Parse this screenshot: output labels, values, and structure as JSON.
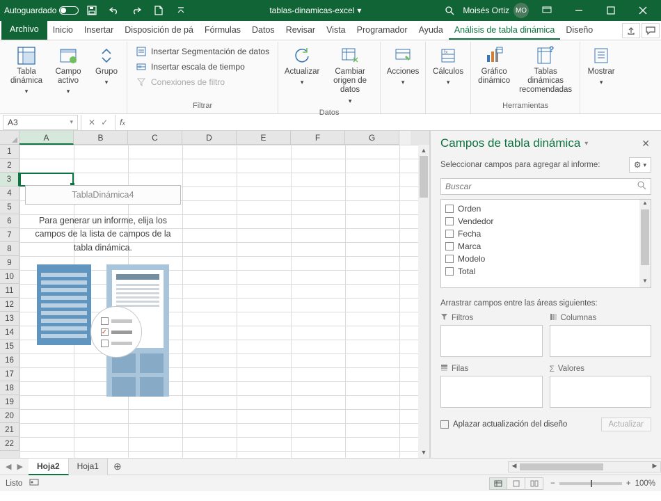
{
  "titlebar": {
    "autosave_label": "Autoguardado",
    "doc_name": "tablas-dinamicas-excel",
    "user_name": "Moisés Ortiz",
    "user_initials": "MO"
  },
  "menu": {
    "file": "Archivo",
    "tabs": [
      "Inicio",
      "Insertar",
      "Disposición de pá",
      "Fórmulas",
      "Datos",
      "Revisar",
      "Vista",
      "Programador",
      "Ayuda",
      "Análisis de tabla dinámica",
      "Diseño"
    ],
    "active_index": 9
  },
  "ribbon": {
    "pivot_table": "Tabla dinámica",
    "active_field": "Campo activo",
    "group": "Grupo",
    "insert_slicer": "Insertar Segmentación de datos",
    "insert_timeline": "Insertar escala de tiempo",
    "filter_connections": "Conexiones de filtro",
    "filter_group_label": "Filtrar",
    "refresh": "Actualizar",
    "change_source": "Cambiar origen de datos",
    "data_group_label": "Datos",
    "actions": "Acciones",
    "calculations": "Cálculos",
    "pivot_chart": "Gráfico dinámico",
    "recommended": "Tablas dinámicas recomendadas",
    "tools_group_label": "Herramientas",
    "show": "Mostrar"
  },
  "formula_bar": {
    "name_box": "A3",
    "formula": ""
  },
  "grid": {
    "columns": [
      "A",
      "B",
      "C",
      "D",
      "E",
      "F",
      "G"
    ],
    "rows": 22,
    "selected_cell": "A3",
    "pivot_placeholder": {
      "title": "TablaDinámica4",
      "message": "Para generar un informe, elija los campos de la lista de campos de la tabla dinámica."
    }
  },
  "field_pane": {
    "title": "Campos de tabla dinámica",
    "subtitle": "Seleccionar campos para agregar al informe:",
    "search_placeholder": "Buscar",
    "fields": [
      "Orden",
      "Vendedor",
      "Fecha",
      "Marca",
      "Modelo",
      "Total"
    ],
    "drag_label": "Arrastrar campos entre las áreas siguientes:",
    "areas": {
      "filters": "Filtros",
      "columns": "Columnas",
      "rows": "Filas",
      "values": "Valores"
    },
    "defer_label": "Aplazar actualización del diseño",
    "update_btn": "Actualizar"
  },
  "sheets": {
    "tabs": [
      "Hoja2",
      "Hoja1"
    ],
    "active_index": 0
  },
  "status": {
    "ready": "Listo",
    "zoom": "100%"
  }
}
